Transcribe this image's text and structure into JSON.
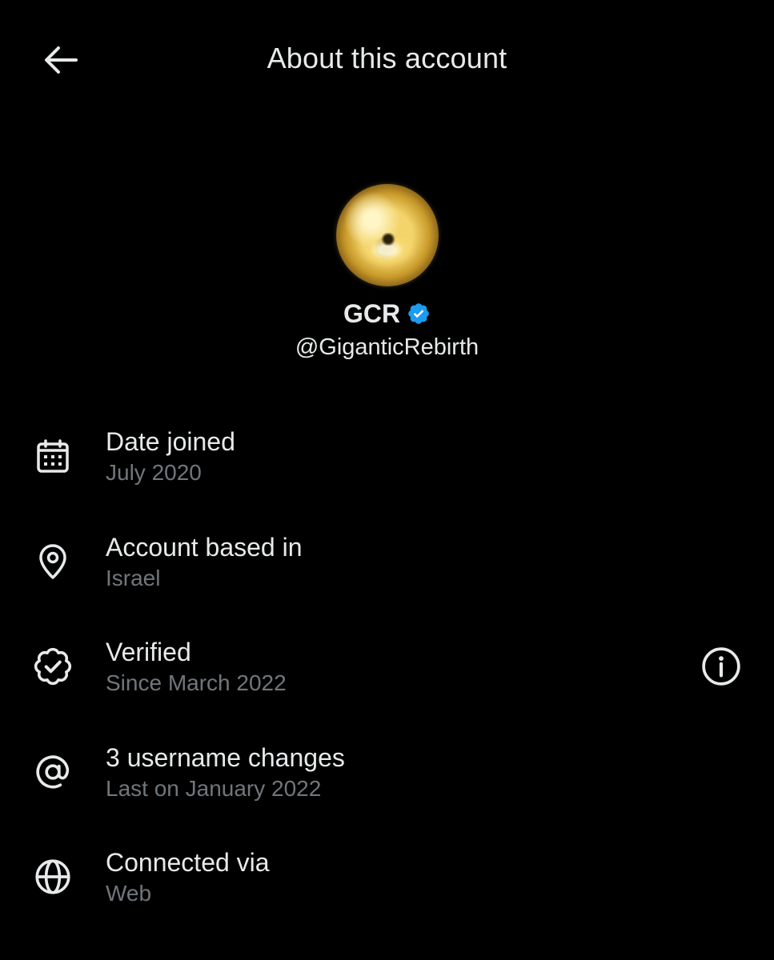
{
  "header": {
    "title": "About this account",
    "back_icon": "arrow-left-icon"
  },
  "profile": {
    "display_name": "GCR",
    "handle": "@GiganticRebirth",
    "verified_badge_color": "#1d9bf0"
  },
  "details": [
    {
      "icon": "calendar-icon",
      "label": "Date joined",
      "value": "July 2020"
    },
    {
      "icon": "location-pin-icon",
      "label": "Account based in",
      "value": "Israel"
    },
    {
      "icon": "verified-badge-outline-icon",
      "label": "Verified",
      "value": "Since March 2022",
      "has_info": true
    },
    {
      "icon": "at-sign-icon",
      "label": "3 username changes",
      "value": "Last on January 2022"
    },
    {
      "icon": "globe-icon",
      "label": "Connected via",
      "value": "Web"
    }
  ],
  "colors": {
    "background": "#000000",
    "primary_text": "#e7e9ea",
    "secondary_text": "#71767b",
    "accent": "#1d9bf0"
  }
}
